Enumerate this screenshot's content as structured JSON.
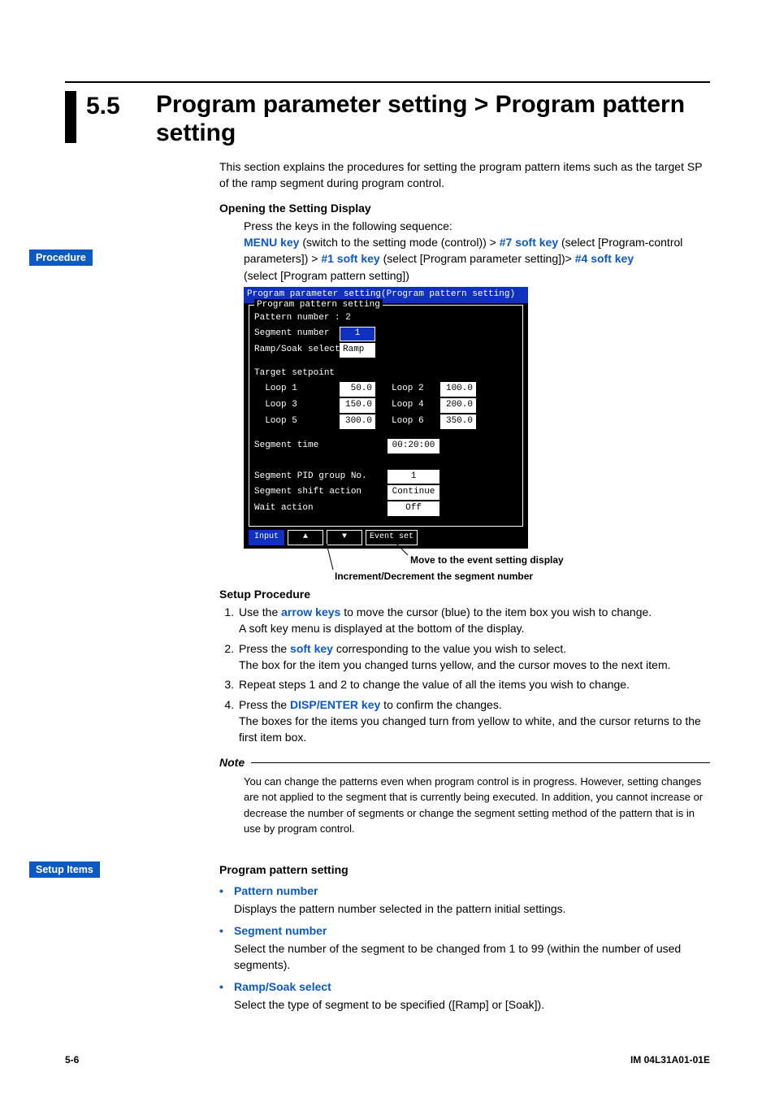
{
  "section_number": "5.5",
  "section_title": "Program parameter setting > Program pattern setting",
  "intro": "This section explains the procedures for setting the program pattern items such as the target SP of the ramp segment during program control.",
  "labels": {
    "procedure": "Procedure",
    "setup_items": "Setup Items",
    "opening_head": "Opening the Setting Display",
    "press_seq": "Press the keys in the following sequence:",
    "k_menu": "MENU key",
    "k_menu_after": " (switch to the setting mode (control)) > ",
    "k_sk7": "#7 soft key",
    "k_sk7_after": " (select [Program-control parameters])   > ",
    "k_sk1": "#1 soft key",
    "k_sk1_after": " (select [Program parameter setting])> ",
    "k_sk4": "#4 soft key",
    "k_sk4_after": " (select [Program pattern setting])",
    "callout_event": "Move to the event setting display",
    "callout_segnum": "Increment/Decrement the segment number",
    "setup_proc_head": "Setup Procedure",
    "step1a": "Use the ",
    "step1_key": "arrow keys",
    "step1b": " to move the cursor (blue) to the item box you wish to change.",
    "step1c": "A soft key menu is displayed at the bottom of the display.",
    "step2a": "Press the ",
    "step2_key": "soft key",
    "step2b": " corresponding to the value you wish to select.",
    "step2c": "The box for the item you changed turns yellow, and the cursor moves to the next item.",
    "step3": "Repeat steps 1 and 2 to change the value of all the items you wish to change.",
    "step4a": "Press the ",
    "step4_key": "DISP/ENTER key",
    "step4b": " to confirm the changes.",
    "step4c": "The boxes for the items you changed turn from yellow to white, and the cursor returns to the first item box.",
    "note_head": "Note",
    "note_body": "You can change the patterns even when program control is in progress.  However, setting changes are not applied to the segment that is currently being executed.  In addition, you cannot increase or decrease the number of segments or change the segment setting method of the pattern that is in use by program control.",
    "items_head": "Program pattern setting",
    "it1_t": "Pattern number",
    "it1_d": "Displays the pattern number selected in the pattern initial settings.",
    "it2_t": "Segment number",
    "it2_d": "Select the number of the segment to be changed from 1 to 99 (within the number of used segments).",
    "it3_t": "Ramp/Soak select",
    "it3_d": "Select the type of segment to be specified ([Ramp] or [Soak])."
  },
  "screenshot": {
    "title": "Program parameter setting(Program pattern setting)",
    "panel_title": "Program pattern setting",
    "pattern_number_label": "Pattern number :  2",
    "segment_number_label": "Segment number",
    "segment_number_val": "1",
    "rampsoak_label": "Ramp/Soak select",
    "rampsoak_val": "Ramp",
    "target_sp": "Target setpoint",
    "loops": [
      {
        "l": "  Loop 1",
        "v": "50.0",
        "l2": "Loop 2",
        "v2": "100.0"
      },
      {
        "l": "  Loop 3",
        "v": "150.0",
        "l2": "Loop 4",
        "v2": "200.0"
      },
      {
        "l": "  Loop 5",
        "v": "300.0",
        "l2": "Loop 6",
        "v2": "350.0"
      }
    ],
    "seg_time_l": "Segment time",
    "seg_time_v": "00:20:00",
    "pid_l": "Segment PID group No.",
    "pid_v": "1",
    "shift_l": "Segment shift action",
    "shift_v": "Continue",
    "wait_l": "Wait action",
    "wait_v": "Off",
    "soft_input": "Input",
    "soft_up": "▲",
    "soft_down": "▼",
    "soft_event": "Event set"
  },
  "footer": {
    "page": "5-6",
    "doc": "IM 04L31A01-01E"
  }
}
